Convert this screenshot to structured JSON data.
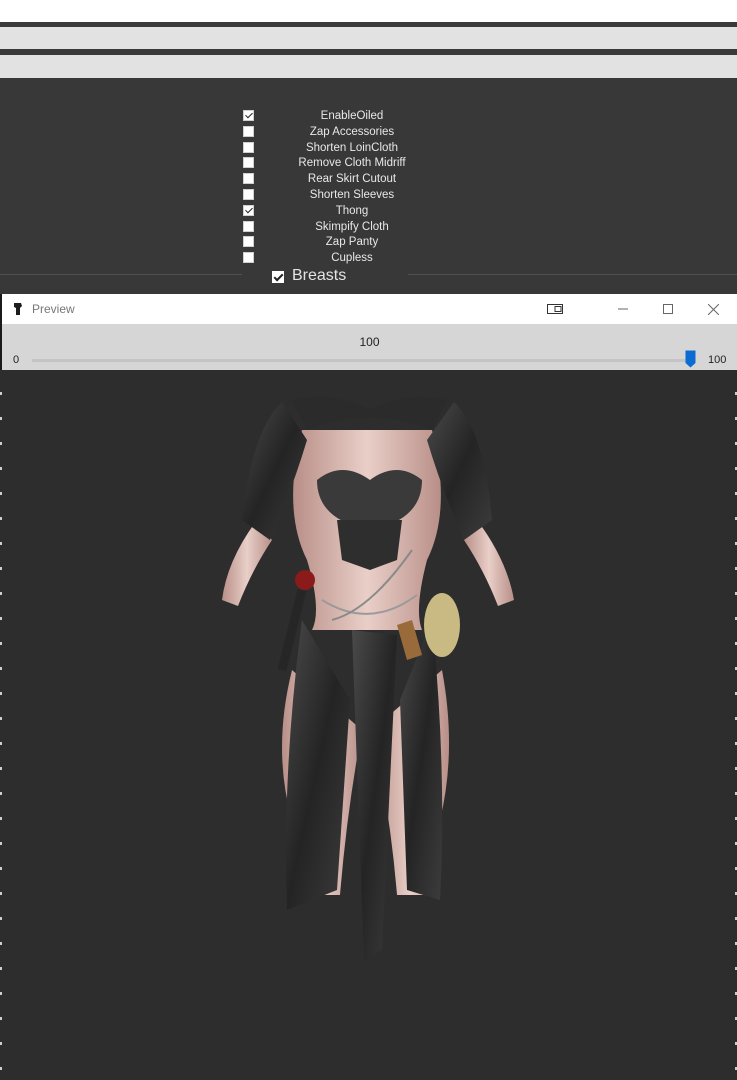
{
  "options": [
    {
      "label": "EnableOiled",
      "checked": true
    },
    {
      "label": "Zap Accessories",
      "checked": false
    },
    {
      "label": "Shorten LoinCloth",
      "checked": false
    },
    {
      "label": "Remove Cloth Midriff",
      "checked": false
    },
    {
      "label": "Rear Skirt Cutout",
      "checked": false
    },
    {
      "label": "Shorten Sleeves",
      "checked": false
    },
    {
      "label": "Thong",
      "checked": true
    },
    {
      "label": "Skimpify Cloth",
      "checked": false
    },
    {
      "label": "Zap Panty",
      "checked": false
    },
    {
      "label": "Cupless",
      "checked": false
    }
  ],
  "section": {
    "label": "Breasts",
    "checked": true
  },
  "preview": {
    "title": "Preview",
    "icons": {
      "app": "app-icon",
      "toggle": "toggle-view-icon",
      "minimize": "minimize-icon",
      "maximize": "maximize-icon",
      "close": "close-icon"
    },
    "slider": {
      "value": "100",
      "min": "0",
      "max": "100",
      "fraction": 1.0
    },
    "model": {
      "description_icon": "3d-outfit-model"
    }
  },
  "colors": {
    "accent": "#0a6bd1",
    "panel_bg": "#383838",
    "viewport_bg": "#2d2d2d",
    "slider_bg": "#d6d6d6"
  }
}
